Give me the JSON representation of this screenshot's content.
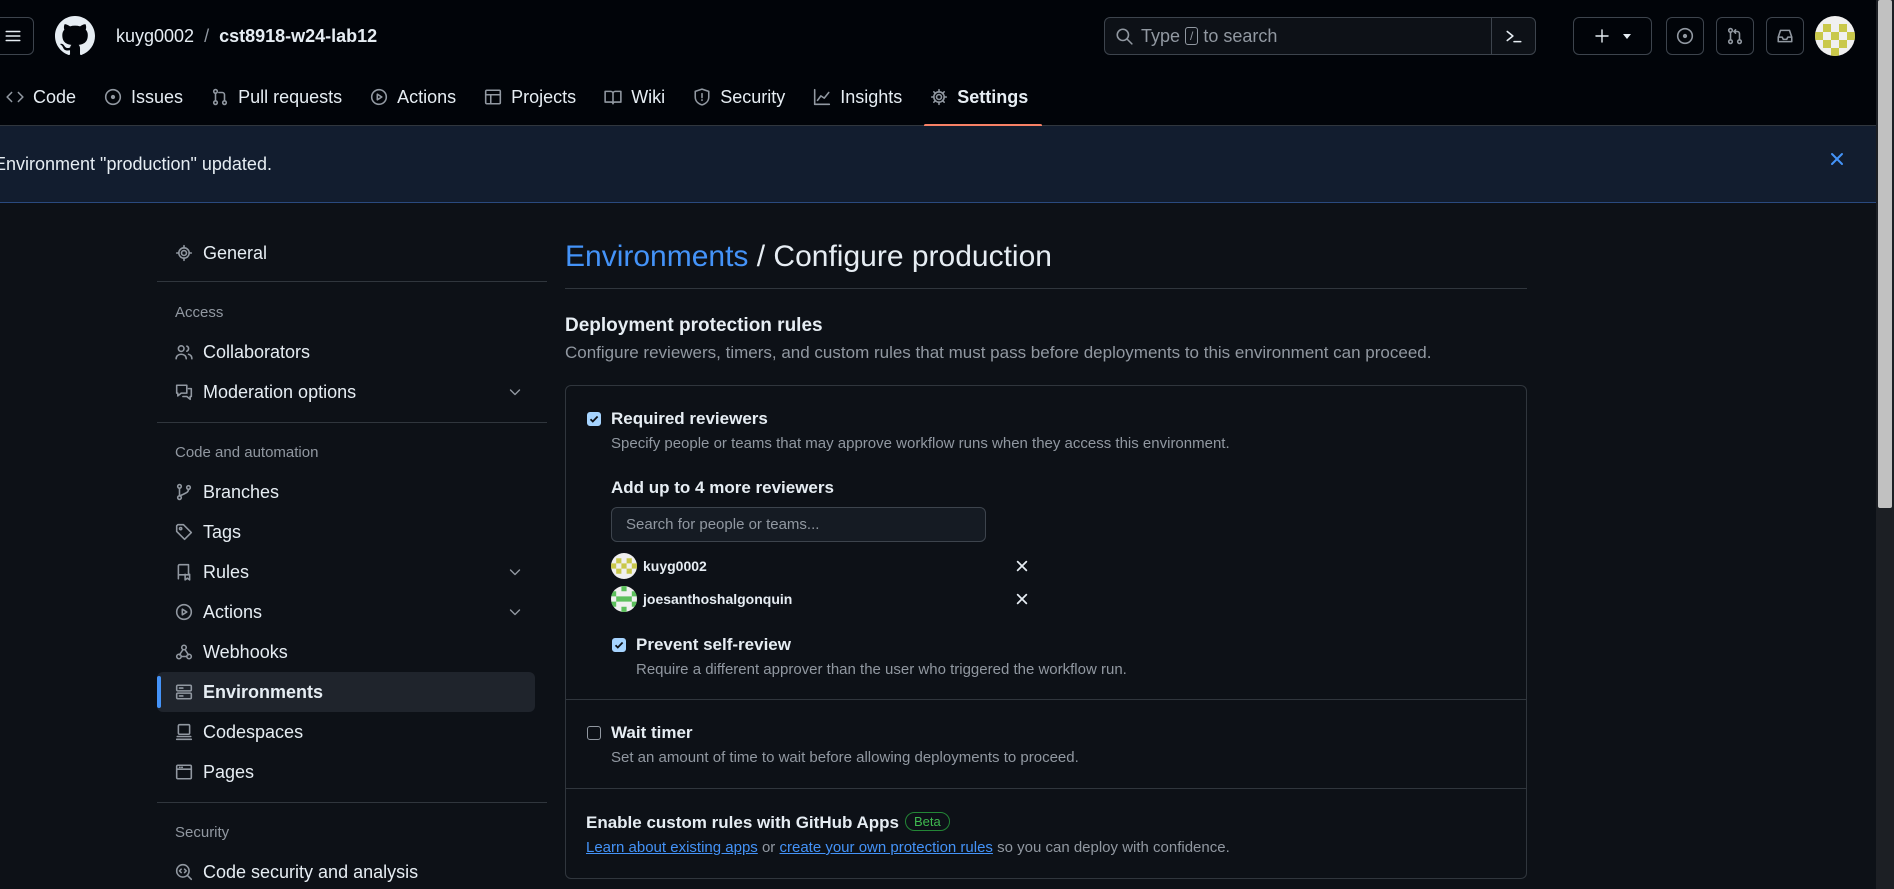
{
  "header": {
    "owner": "kuyg0002",
    "separator": "/",
    "repo": "cst8918-w24-lab12",
    "search": {
      "prefix": "Type",
      "key": "/",
      "suffix": "to search"
    },
    "icons": [
      "hamburger-icon",
      "github-logo",
      "search-icon",
      "terminal-icon",
      "plus-icon",
      "caret-down-icon",
      "issue-opened-icon",
      "git-pull-request-icon",
      "inbox-icon",
      "avatar"
    ]
  },
  "tabs": [
    {
      "label": "Code",
      "icon": "code-icon"
    },
    {
      "label": "Issues",
      "icon": "issue-opened-icon"
    },
    {
      "label": "Pull requests",
      "icon": "git-pull-request-icon"
    },
    {
      "label": "Actions",
      "icon": "play-icon"
    },
    {
      "label": "Projects",
      "icon": "table-icon"
    },
    {
      "label": "Wiki",
      "icon": "book-icon"
    },
    {
      "label": "Security",
      "icon": "shield-icon"
    },
    {
      "label": "Insights",
      "icon": "graph-icon"
    },
    {
      "label": "Settings",
      "icon": "gear-icon",
      "active": true
    }
  ],
  "flash": {
    "message": "Environment \"production\" updated."
  },
  "sidebar": {
    "general": "General",
    "access_heading": "Access",
    "collaborators": "Collaborators",
    "moderation": "Moderation options",
    "code_heading": "Code and automation",
    "branches": "Branches",
    "tags": "Tags",
    "rules": "Rules",
    "actions": "Actions",
    "webhooks": "Webhooks",
    "environments": "Environments",
    "codespaces": "Codespaces",
    "pages": "Pages",
    "security_heading": "Security",
    "code_security": "Code security and analysis"
  },
  "main": {
    "breadcrumb_link": "Environments",
    "breadcrumb_rest": " / Configure production",
    "section_title": "Deployment protection rules",
    "section_desc": "Configure reviewers, timers, and custom rules that must pass before deployments to this environment can proceed.",
    "required_reviewers": {
      "title": "Required reviewers",
      "checked": true,
      "desc": "Specify people or teams that may approve workflow runs when they access this environment.",
      "add_label": "Add up to 4 more reviewers",
      "search_placeholder": "Search for people or teams...",
      "reviewers": [
        "kuyg0002",
        "joesanthoshalgonquin"
      ]
    },
    "prevent_self_review": {
      "title": "Prevent self-review",
      "checked": true,
      "desc": "Require a different approver than the user who triggered the workflow run."
    },
    "wait_timer": {
      "title": "Wait timer",
      "checked": false,
      "desc": "Set an amount of time to wait before allowing deployments to proceed."
    },
    "custom_rules": {
      "title": "Enable custom rules with GitHub Apps",
      "badge": "Beta",
      "link1": "Learn about existing apps",
      "mid": "or",
      "link2": "create your own protection rules",
      "tail": "so you can deploy with confidence."
    }
  },
  "colors": {
    "accent": "#4493f8",
    "active_tab": "#f78166",
    "success": "#3fb950"
  }
}
